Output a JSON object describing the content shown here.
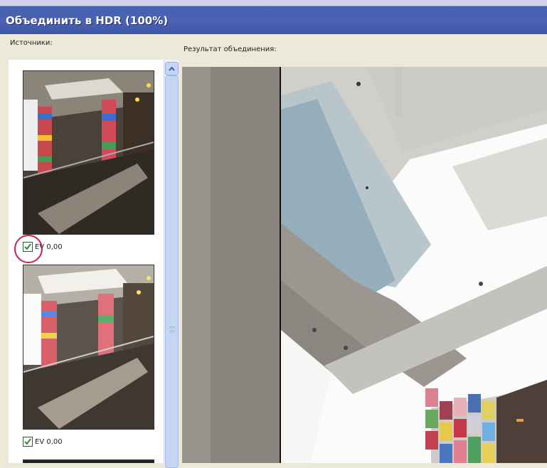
{
  "window": {
    "title": "Объединить в HDR (100%)"
  },
  "sources_panel": {
    "label": "Источники:",
    "items": [
      {
        "ev_label": "EV 0,00",
        "checked": true
      },
      {
        "ev_label": "EV 0,00",
        "checked": true
      }
    ]
  },
  "result_panel": {
    "label": "Результат объединения:"
  },
  "colors": {
    "accent": "#4460b0",
    "highlight_ring": "#c8244b",
    "checkbox_check": "#2f8a2f"
  }
}
